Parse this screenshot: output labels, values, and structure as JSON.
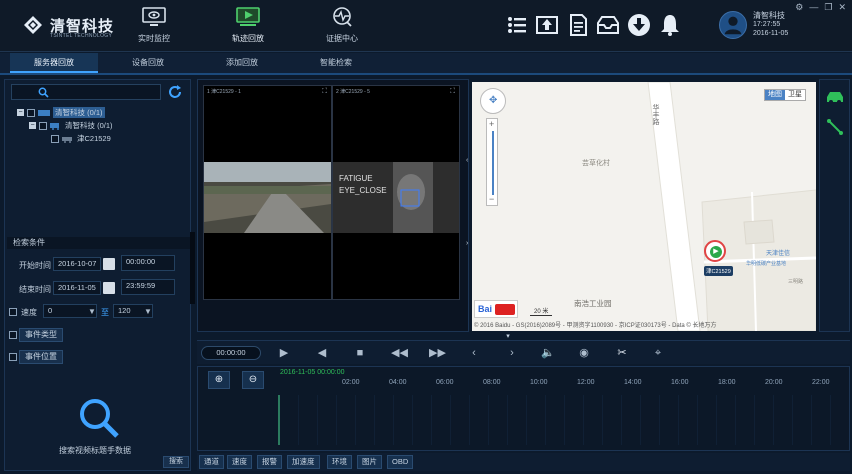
{
  "header": {
    "logo_name": "清智科技",
    "logo_sub": "TSINTEL TECHNOLOGY",
    "nav": [
      {
        "label": "实时监控",
        "icon": "monitor-icon"
      },
      {
        "label": "轨迹回放",
        "icon": "playback-icon"
      },
      {
        "label": "证据中心",
        "icon": "evidence-icon"
      }
    ],
    "tools": [
      "list-icon",
      "upload-icon",
      "document-icon",
      "inbox-icon",
      "download-icon",
      "bell-icon"
    ],
    "user": {
      "name": "清智科技",
      "time": "17:27:55",
      "date": "2016-11-05"
    },
    "window_controls": [
      "⚙",
      "—",
      "❐",
      "✕"
    ]
  },
  "subtabs": [
    "服务器回放",
    "设备回放",
    "添加回放",
    "智能检索"
  ],
  "left_panel": {
    "search_placeholder": "",
    "tree": [
      {
        "label": "清智科技  (0/1)",
        "level": 0
      },
      {
        "label": "清智科技  (0/1)",
        "level": 1
      },
      {
        "label": "津C21529",
        "level": 2
      }
    ],
    "conditions_title": "检索条件",
    "start_label": "开始时间",
    "start_date": "2016-10-07",
    "start_time": "00:00:00",
    "end_label": "结束时间",
    "end_date": "2016-11-05",
    "end_time": "23:59:59",
    "speed_label": "速度",
    "speed_from": "0",
    "speed_to_label": "至",
    "speed_to": "120",
    "event_type_label": "事件类型",
    "event_location_label": "事件位置",
    "empty_text": "搜索视频标题手数据",
    "search_button": "搜索"
  },
  "video": {
    "cells": [
      {
        "header": "1 津C21529 - 1",
        "feed": "road"
      },
      {
        "header": "2 津C21529 - 5",
        "feed": "driver"
      },
      {
        "header": "",
        "feed": "empty"
      },
      {
        "header": "",
        "feed": "empty"
      }
    ],
    "overlay_text": [
      "FATIGUE",
      "EYE_CLOSE"
    ]
  },
  "map": {
    "type_normal": "地图",
    "type_satellite": "卫星",
    "road_label": "华丰路",
    "poi1": "芸草化村",
    "poi2": "南浩工业园",
    "poi3": "天津佳信",
    "poi4": "华明低碳产业基地",
    "poi5": "三明路",
    "vehicle_label": "津C21529",
    "scale": "20 米",
    "copyright": "© 2016 Baidu - GS(2016)2089号 - 甲测资字1100930 - 京ICP证030173号 - Data © 长地万方"
  },
  "player": {
    "time": "00:00:00",
    "controls": [
      "play-icon",
      "prev-icon",
      "stop-icon",
      "rewind-icon",
      "forward-icon",
      "step-back-icon",
      "step-forward-icon",
      "volume-icon",
      "snapshot-icon",
      "cut-icon",
      "location-icon"
    ]
  },
  "timeline": {
    "current": "2016-11-05 00:00:00",
    "ticks": [
      "02:00",
      "04:00",
      "06:00",
      "08:00",
      "10:00",
      "12:00",
      "14:00",
      "16:00",
      "18:00",
      "20:00",
      "22:00"
    ]
  },
  "bottom_tabs": [
    "通道",
    "速度",
    "报警",
    "加速度",
    "环境",
    "图片",
    "OBD"
  ]
}
